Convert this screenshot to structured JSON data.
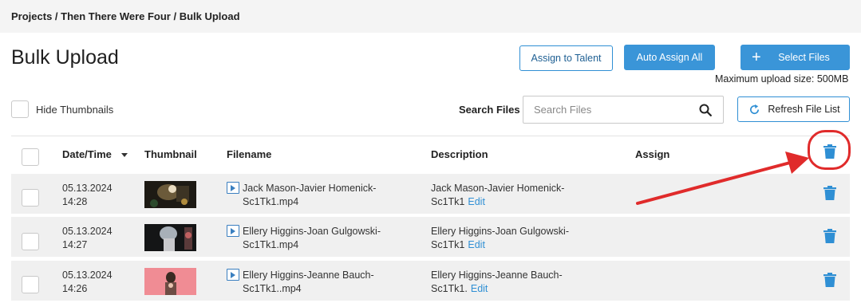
{
  "breadcrumb": "Projects / Then There Were Four / Bulk Upload",
  "page_title": "Bulk Upload",
  "buttons": {
    "assign_to_talent": "Assign to Talent",
    "auto_assign_all": "Auto Assign All",
    "select_files": "Select Files",
    "refresh_file_list": "Refresh File List"
  },
  "max_upload": "Maximum upload size: 500MB",
  "hide_thumbnails_label": "Hide Thumbnails",
  "search": {
    "label": "Search Files",
    "placeholder": "Search Files"
  },
  "table": {
    "headers": {
      "datetime": "Date/Time",
      "thumbnail": "Thumbnail",
      "filename": "Filename",
      "description": "Description",
      "assign": "Assign"
    },
    "rows": [
      {
        "date": "05.13.2024",
        "time": "14:28",
        "filename_1": "Jack Mason-Javier Homenick-",
        "filename_2": "Sc1Tk1.mp4",
        "desc_1": "Jack Mason-Javier Homenick-",
        "desc_2": "Sc1Tk1",
        "edit": "Edit"
      },
      {
        "date": "05.13.2024",
        "time": "14:27",
        "filename_1": "Ellery Higgins-Joan Gulgowski-",
        "filename_2": "Sc1Tk1.mp4",
        "desc_1": "Ellery Higgins-Joan Gulgowski-",
        "desc_2": "Sc1Tk1",
        "edit": "Edit"
      },
      {
        "date": "05.13.2024",
        "time": "14:26",
        "filename_1": "Ellery Higgins-Jeanne Bauch-",
        "filename_2": "Sc1Tk1..mp4",
        "desc_1": "Ellery Higgins-Jeanne Bauch-",
        "desc_2": "Sc1Tk1.",
        "edit": "Edit"
      }
    ]
  },
  "colors": {
    "accent": "#3a95d8",
    "link": "#2f8fd4",
    "annotation": "#e02b2b",
    "row_bg": "#f0f0f0"
  },
  "icons": [
    "plus-icon",
    "search-icon",
    "refresh-icon",
    "sort-down-icon",
    "video-file-icon",
    "trash-icon"
  ]
}
